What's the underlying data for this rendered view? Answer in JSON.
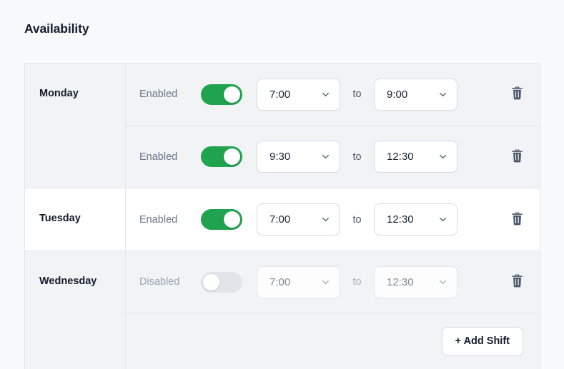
{
  "page": {
    "title": "Availability",
    "background": "#f8f9fb"
  },
  "colors": {
    "toggle_on": "#1fa34f",
    "toggle_off": "#e2e4e9",
    "row_gray": "#f1f3f5",
    "row_white": "#ffffff",
    "border": "#e3e6ea",
    "text_primary": "#141c2b",
    "text_muted": "#6b7688",
    "text_disabled": "#9aa3b2"
  },
  "table": {
    "to_label": "to",
    "to_label_disabled": "to",
    "enabled_label": "Enabled",
    "disabled_label": "Disabled",
    "trash_icon": "trash-icon",
    "chevron_icon": "chevron-down-icon",
    "days": [
      {
        "name": "Monday",
        "stripe": "gray",
        "shifts": [
          {
            "state_label": "Enabled",
            "enabled": true,
            "start": "7:00",
            "end": "9:00",
            "to": "to"
          },
          {
            "state_label": "Enabled",
            "enabled": true,
            "start": "9:30",
            "end": "12:30",
            "to": "to"
          }
        ]
      },
      {
        "name": "Tuesday",
        "stripe": "white",
        "shifts": [
          {
            "state_label": "Enabled",
            "enabled": true,
            "start": "7:00",
            "end": "12:30",
            "to": "to"
          }
        ]
      },
      {
        "name": "Wednesday",
        "stripe": "gray",
        "shifts": [
          {
            "state_label": "Disabled",
            "enabled": false,
            "start": "7:00",
            "end": "12:30",
            "to": "to"
          }
        ],
        "add_shift_label": "+ Add Shift"
      }
    ]
  }
}
